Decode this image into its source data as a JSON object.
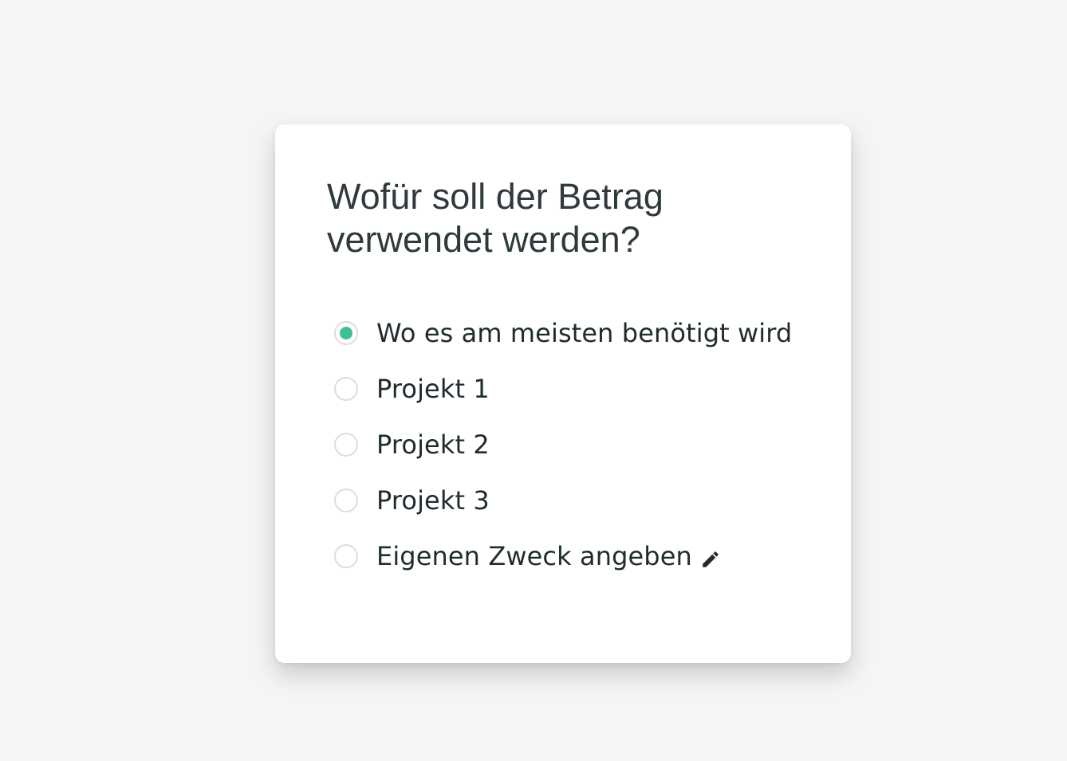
{
  "question": {
    "title": "Wofür soll der Betrag verwendet werden?"
  },
  "options": [
    {
      "label": "Wo es am meisten benötigt wird",
      "selected": true
    },
    {
      "label": "Projekt 1",
      "selected": false
    },
    {
      "label": "Projekt 2",
      "selected": false
    },
    {
      "label": "Projekt 3",
      "selected": false
    },
    {
      "label": "Eigenen Zweck angeben",
      "selected": false,
      "icon": "pencil-icon"
    }
  ],
  "colors": {
    "accent": "#3cc196",
    "background": "#f5f5f5",
    "card": "#ffffff",
    "text": "#1f2b2e"
  }
}
